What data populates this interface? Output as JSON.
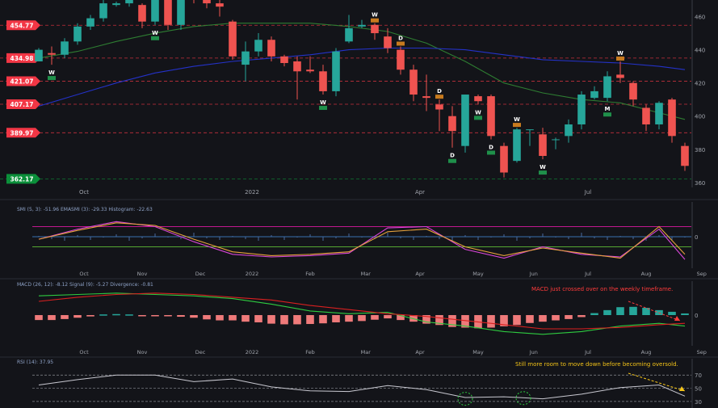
{
  "colors": {
    "background": "#131419",
    "up": "#26a69a",
    "down": "#ef5350",
    "ma_green": "#2e7d32",
    "ma_blue": "#2432c8",
    "level_red": "#f23645",
    "level_green": "#0b8f3a",
    "smi": "#d946d8",
    "smi_ema": "#e6a23c",
    "macd": "#2ecc40",
    "macd_signal": "#d92020",
    "hist_pos": "#26a69a",
    "hist_neg": "#ef7a7a",
    "rsi": "#c8c8d0",
    "note_red": "#ff3b3b",
    "note_yellow": "#f5c518"
  },
  "chart_data": [
    {
      "type": "candlestick",
      "ylim": [
        357,
        470
      ],
      "y_ticks": [
        "460",
        "440",
        "420",
        "400",
        "380",
        "360"
      ],
      "y_tick_values": [
        460,
        440,
        420,
        400,
        380,
        360
      ],
      "month_labels": [
        "Oct",
        "2022",
        "Apr",
        "Jul"
      ],
      "month_positions": [
        3.5,
        16.5,
        29.5,
        42.5
      ],
      "price_levels": [
        {
          "label": "454.77",
          "value": 454.77,
          "color": "red"
        },
        {
          "label": "434.98",
          "value": 434.98,
          "color": "red"
        },
        {
          "label": "421.07",
          "value": 421.07,
          "color": "red"
        },
        {
          "label": "407.17",
          "value": 407.17,
          "color": "red"
        },
        {
          "label": "389.97",
          "value": 389.97,
          "color": "red"
        },
        {
          "label": "362.17",
          "value": 362.17,
          "color": "green"
        }
      ],
      "candles": [
        [
          433,
          440,
          438,
          441
        ],
        [
          438,
          437,
          431,
          442
        ],
        [
          437,
          445,
          435,
          447
        ],
        [
          445,
          454,
          443,
          456
        ],
        [
          454,
          459,
          452,
          461
        ],
        [
          459,
          468,
          457,
          470
        ],
        [
          467,
          468,
          466,
          469
        ],
        [
          468,
          470,
          466,
          472
        ],
        [
          467,
          457,
          453,
          468
        ],
        [
          457,
          470,
          455,
          471
        ],
        [
          470,
          455,
          452,
          471
        ],
        [
          455,
          471,
          452,
          473
        ],
        [
          471,
          470,
          468,
          476
        ],
        [
          470,
          468,
          465,
          475
        ],
        [
          468,
          466,
          460,
          470
        ],
        [
          457,
          436,
          434,
          458
        ],
        [
          431,
          439,
          421,
          445
        ],
        [
          439,
          446,
          436,
          450
        ],
        [
          446,
          436,
          433,
          448
        ],
        [
          436,
          432,
          430,
          437
        ],
        [
          433,
          427,
          410,
          436
        ],
        [
          428,
          427,
          426,
          436
        ],
        [
          427,
          415,
          413,
          431
        ],
        [
          415,
          439,
          412,
          441
        ],
        [
          445,
          453,
          444,
          461
        ],
        [
          454,
          455,
          453,
          458
        ],
        [
          455,
          450,
          446,
          456
        ],
        [
          448,
          441,
          438,
          453
        ],
        [
          440,
          428,
          425,
          442
        ],
        [
          428,
          413,
          409,
          431
        ],
        [
          412,
          411,
          403,
          425
        ],
        [
          407,
          404,
          391,
          410
        ],
        [
          400,
          391,
          381,
          406
        ],
        [
          382,
          413,
          378,
          413
        ],
        [
          412,
          409,
          407,
          413
        ],
        [
          412,
          388,
          386,
          413
        ],
        [
          382,
          366,
          363,
          384
        ],
        [
          373,
          392,
          372,
          393
        ],
        [
          392,
          392,
          382,
          392
        ],
        [
          389,
          376,
          374,
          393
        ],
        [
          386,
          386,
          380,
          387
        ],
        [
          388,
          395,
          384,
          398
        ],
        [
          395,
          413,
          392,
          415
        ],
        [
          411,
          415,
          410,
          418
        ],
        [
          411,
          424,
          409,
          427
        ],
        [
          425,
          423,
          420,
          433
        ],
        [
          420,
          410,
          406,
          421
        ],
        [
          405,
          395,
          391,
          407
        ],
        [
          395,
          408,
          392,
          409
        ],
        [
          410,
          388,
          384,
          411
        ],
        [
          382,
          370,
          367,
          384
        ]
      ],
      "ma_green": [
        [
          0,
          435
        ],
        [
          3,
          439
        ],
        [
          6,
          445
        ],
        [
          9,
          450
        ],
        [
          12,
          454
        ],
        [
          15,
          456
        ],
        [
          18,
          456
        ],
        [
          21,
          456
        ],
        [
          24,
          454
        ],
        [
          27,
          451
        ],
        [
          30,
          444
        ],
        [
          33,
          433
        ],
        [
          36,
          420
        ],
        [
          39,
          414
        ],
        [
          42,
          410
        ],
        [
          45,
          408
        ],
        [
          48,
          402
        ],
        [
          50,
          398
        ]
      ],
      "ma_blue": [
        [
          0,
          406
        ],
        [
          3,
          413
        ],
        [
          6,
          420
        ],
        [
          9,
          426
        ],
        [
          12,
          430
        ],
        [
          15,
          433
        ],
        [
          18,
          435
        ],
        [
          21,
          437
        ],
        [
          24,
          440
        ],
        [
          27,
          441
        ],
        [
          30,
          441
        ],
        [
          33,
          440
        ],
        [
          36,
          437
        ],
        [
          39,
          434
        ],
        [
          42,
          433
        ],
        [
          45,
          432
        ],
        [
          48,
          430
        ],
        [
          50,
          428
        ]
      ],
      "markers": [
        {
          "i": 1,
          "side": "below",
          "label": "W",
          "color": "green"
        },
        {
          "i": 9,
          "side": "below",
          "label": "W",
          "color": "green"
        },
        {
          "i": 22,
          "side": "below",
          "label": "W",
          "color": "green"
        },
        {
          "i": 26,
          "side": "above",
          "label": "W",
          "color": "red"
        },
        {
          "i": 28,
          "side": "above",
          "label": "D",
          "color": "red"
        },
        {
          "i": 31,
          "side": "above",
          "label": "D",
          "color": "red"
        },
        {
          "i": 32,
          "side": "below",
          "label": "D",
          "color": "green"
        },
        {
          "i": 34,
          "side": "below",
          "label": "W",
          "color": "green"
        },
        {
          "i": 35,
          "side": "below",
          "label": "D",
          "color": "green"
        },
        {
          "i": 37,
          "side": "above",
          "label": "W",
          "color": "red"
        },
        {
          "i": 39,
          "side": "below",
          "label": "W",
          "color": "green"
        },
        {
          "i": 44,
          "side": "below",
          "label": "M",
          "color": "green"
        },
        {
          "i": 45,
          "side": "above",
          "label": "W",
          "color": "red"
        }
      ]
    },
    {
      "type": "line",
      "title": "SMI (5, 3): -51.96  EMASMI (3): -29.33  Histogram: -22.63",
      "ylim": [
        -125,
        125
      ],
      "y_ticks": [
        "0"
      ],
      "y_tick_values": [
        0
      ],
      "levels": [
        40,
        -40
      ],
      "x": [
        0,
        3,
        6,
        9,
        12,
        15,
        18,
        21,
        24,
        27,
        30,
        33,
        36,
        39,
        42,
        45,
        48,
        50
      ],
      "series": [
        {
          "values": [
            -10,
            30,
            60,
            40,
            -20,
            -70,
            -80,
            -75,
            -65,
            35,
            40,
            -50,
            -85,
            -40,
            -70,
            -80,
            30,
            -90
          ]
        },
        {
          "values": [
            -10,
            25,
            55,
            45,
            -10,
            -60,
            -75,
            -70,
            -60,
            20,
            30,
            -40,
            -75,
            -45,
            -65,
            -85,
            40,
            -70
          ]
        }
      ]
    },
    {
      "type": "line",
      "title": "MACD (26, 12): -8.12  Signal (9): -5.27  Divergence: -0.81",
      "ylim": [
        -20,
        20
      ],
      "y_ticks": [
        "0"
      ],
      "y_tick_values": [
        0
      ],
      "x": [
        0,
        3,
        6,
        9,
        12,
        15,
        18,
        21,
        24,
        27,
        30,
        33,
        36,
        39,
        42,
        45,
        48,
        50
      ],
      "series": [
        {
          "values": [
            14,
            15,
            16,
            15,
            14,
            12,
            8,
            3,
            1,
            2,
            -5,
            -8,
            -12,
            -14,
            -12,
            -8,
            -6,
            -8
          ]
        },
        {
          "values": [
            10,
            13,
            15,
            16,
            15,
            13,
            11,
            7,
            4,
            1,
            -1,
            -4,
            -7,
            -10,
            -10,
            -9,
            -7,
            -6
          ]
        }
      ],
      "histogram": [
        -1.5,
        -1.5,
        -1.2,
        -0.8,
        -0.4,
        0.2,
        0.3,
        0.2,
        -0.3,
        -0.3,
        -0.3,
        -0.5,
        -0.8,
        -1.3,
        -1.6,
        -1.6,
        -2.0,
        -2.2,
        -2.6,
        -2.8,
        -2.8,
        -2.7,
        -2.5,
        -2.2,
        -2.0,
        -1.8,
        -1.4,
        -1.0,
        -1.5,
        -2.0,
        -2.6,
        -3.0,
        -3.6,
        -3.8,
        -4.0,
        -3.8,
        -3.4,
        -3.0,
        -2.4,
        -2.0,
        -1.6,
        -1.2,
        -0.6,
        0.6,
        1.5,
        2.4,
        2.5,
        2.2,
        1.5,
        1.0,
        0.5
      ],
      "annotation": "MACD just crossed over on the weekly timeframe."
    },
    {
      "type": "line",
      "title": "RSI (14): 37.95",
      "ylim": [
        20,
        85
      ],
      "y_ticks": [
        "70",
        "50",
        "30"
      ],
      "y_tick_values": [
        70,
        50,
        30
      ],
      "levels": [
        70,
        50,
        30
      ],
      "x": [
        0,
        3,
        6,
        9,
        12,
        15,
        18,
        21,
        24,
        27,
        30,
        33,
        36,
        39,
        42,
        45,
        48,
        50
      ],
      "series": [
        {
          "values": [
            55,
            63,
            70,
            70,
            60,
            64,
            52,
            46,
            45,
            54,
            48,
            36,
            37,
            34,
            41,
            51,
            55,
            38
          ]
        }
      ],
      "annotation": "Still more room to move down before becoming oversold."
    }
  ],
  "x_axis_labels": [
    "Oct",
    "Nov",
    "Dec",
    "2022",
    "Feb",
    "Mar",
    "Apr",
    "May",
    "Jun",
    "Jul",
    "Aug",
    "Sep"
  ],
  "x_axis_positions": [
    3.5,
    8,
    12.5,
    16.5,
    21,
    25.3,
    29.5,
    34,
    38.3,
    42.5,
    47,
    51.3
  ]
}
